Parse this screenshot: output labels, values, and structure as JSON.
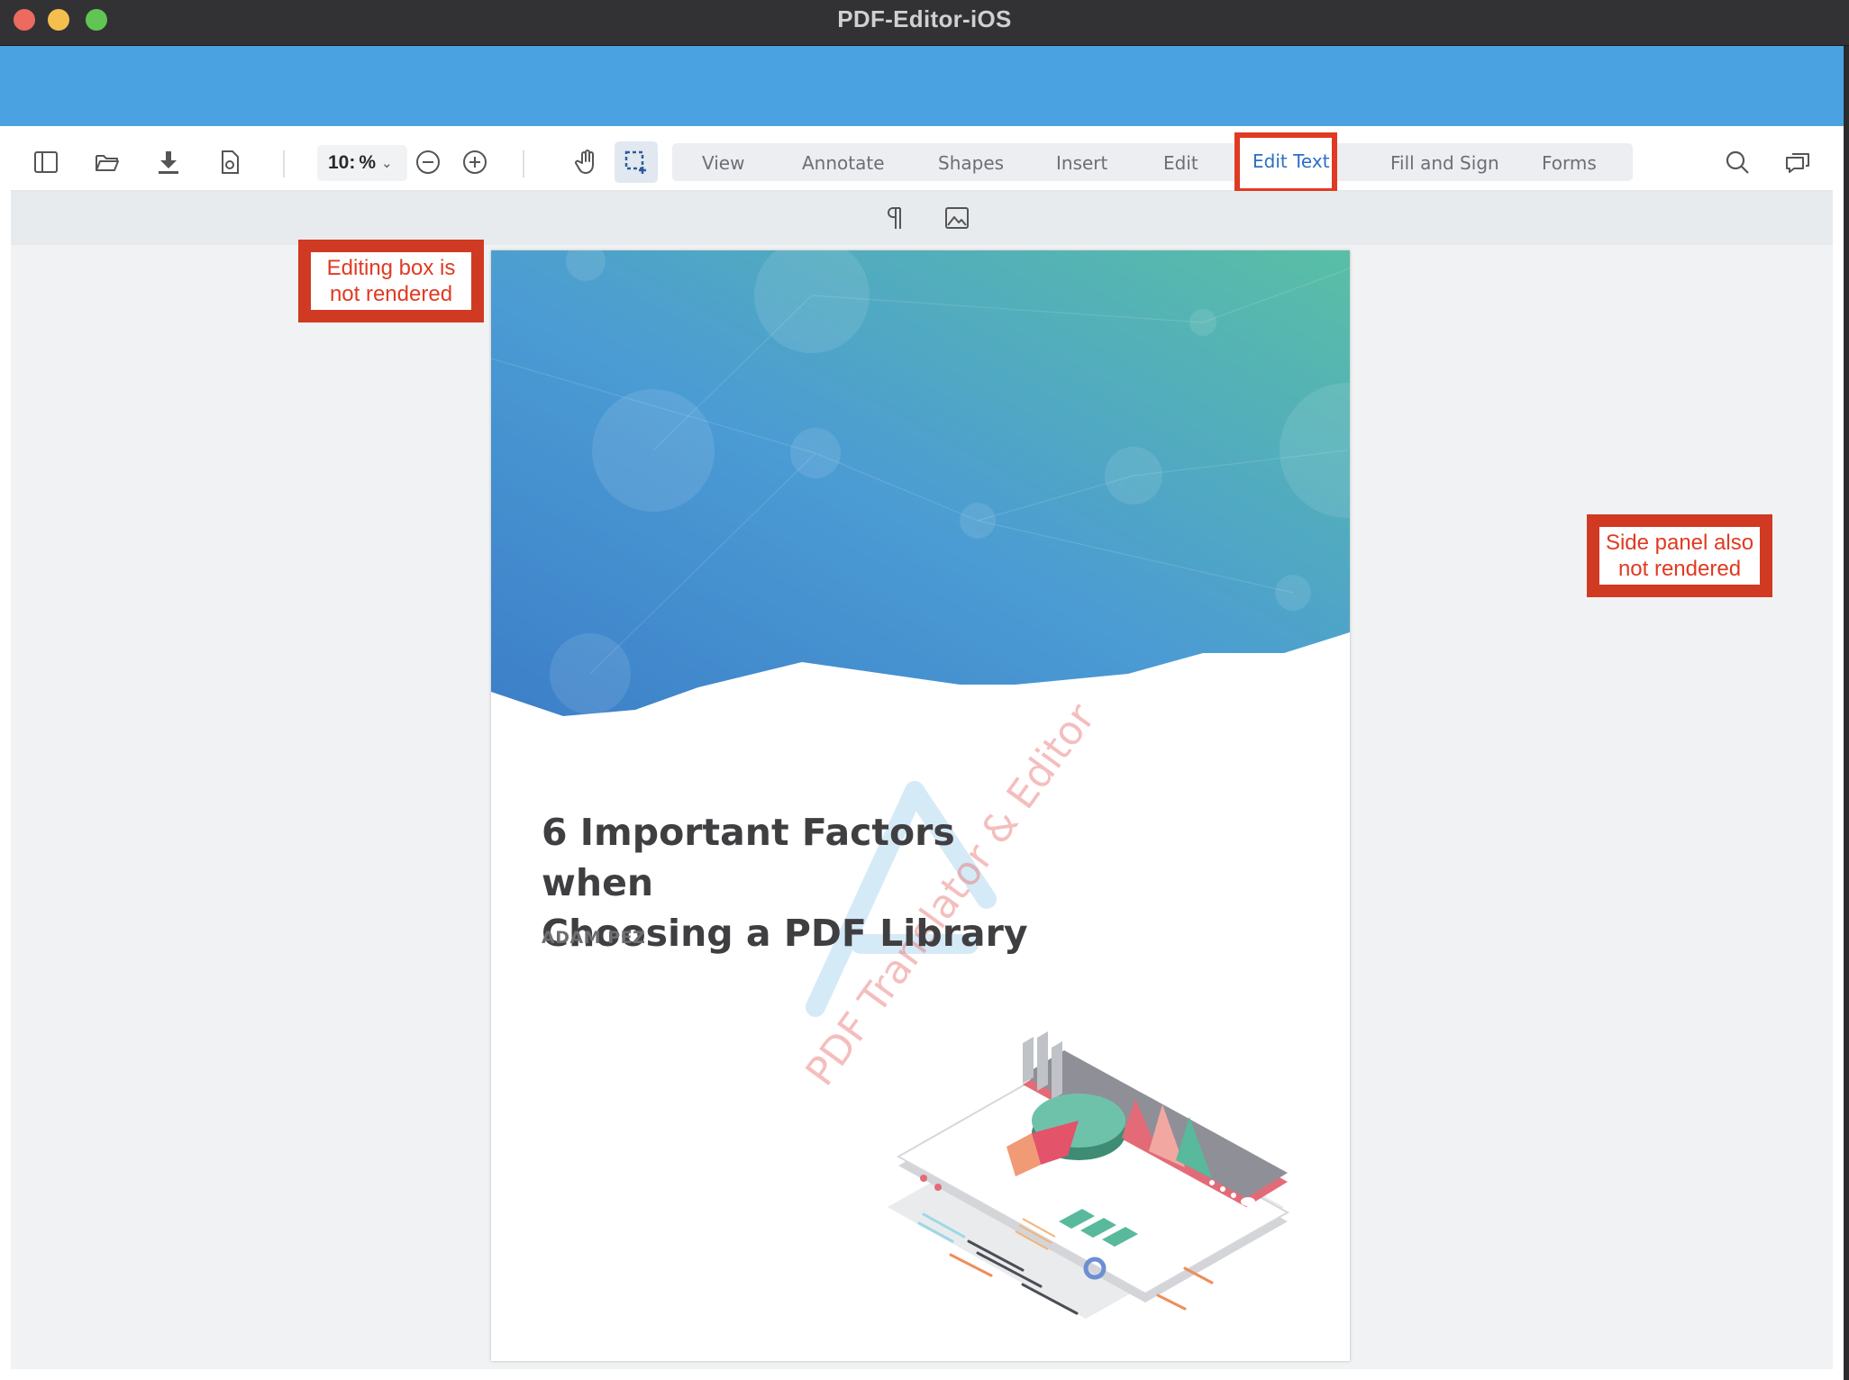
{
  "window": {
    "title": "PDF-Editor-iOS"
  },
  "toolbar": {
    "zoom_value": "10:",
    "zoom_unit": "%",
    "tabs": [
      "View",
      "Annotate",
      "Shapes",
      "Insert",
      "Edit",
      "Edit Text",
      "Fill and Sign",
      "Forms"
    ],
    "active_tab": "Edit Text"
  },
  "document": {
    "title_line1": "6 Important Factors when",
    "title_line2": "Choosing a PDF Library",
    "author": "ADAM PEZ",
    "watermark": "PDF Translator & Editor"
  },
  "annotations": {
    "editing_box_line1": "Editing box is",
    "editing_box_line2": "not rendered",
    "side_panel_line1": "Side panel also",
    "side_panel_line2": "not rendered"
  },
  "colors": {
    "accent": "#4aa3e0",
    "active_tab": "#2b6fc6",
    "highlight_border": "#e03a22"
  },
  "icons": [
    "sidebar-toggle-icon",
    "open-folder-icon",
    "download-icon",
    "document-settings-icon",
    "zoom-out-icon",
    "zoom-in-icon",
    "pan-hand-icon",
    "marquee-select-icon",
    "paragraph-icon",
    "image-icon",
    "search-icon",
    "comments-icon"
  ]
}
